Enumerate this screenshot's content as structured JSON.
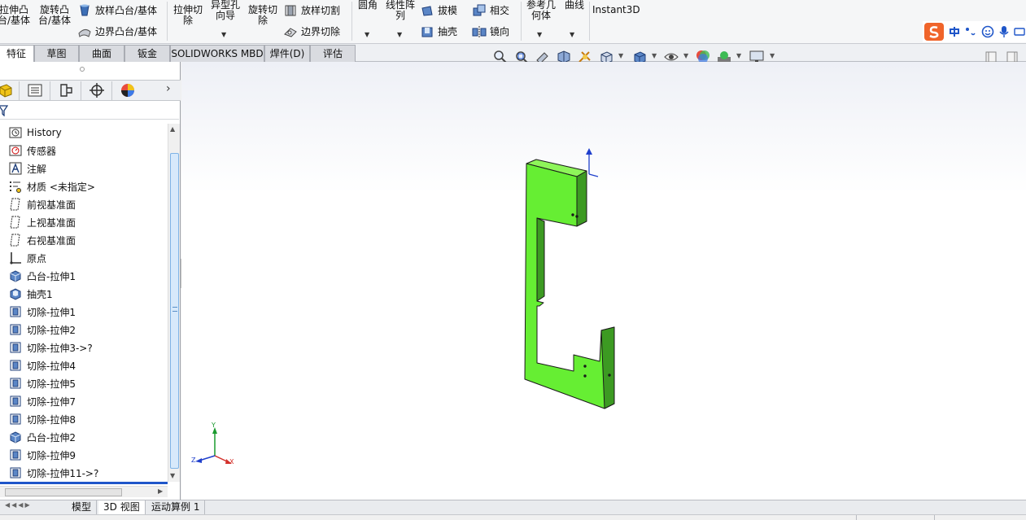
{
  "ribbon": {
    "extrude_boss": "拉伸凸\n台/基体",
    "revolve_boss": "旋转凸\n台/基体",
    "loft_boss": "放样凸台/基体",
    "boundary_boss": "边界凸台/基体",
    "extrude_cut": "拉伸切\n除",
    "hole_wizard": "异型孔\n向导",
    "revolve_cut": "旋转切\n除",
    "loft_cut": "放样切割",
    "boundary_cut": "边界切除",
    "fillet": "圆角",
    "linear_pattern": "线性阵\n列",
    "draft": "拔模",
    "shell": "抽壳",
    "intersect": "相交",
    "mirror": "镜向",
    "ref_geometry": "参考几\n何体",
    "curves": "曲线",
    "instant3d": "Instant3D"
  },
  "tabs": [
    "特征",
    "草图",
    "曲面",
    "钣金",
    "SOLIDWORKS MBD",
    "焊件(D)",
    "评估"
  ],
  "tree": {
    "items": [
      {
        "label": "History",
        "icon": "history-icon"
      },
      {
        "label": "传感器",
        "icon": "sensor-icon"
      },
      {
        "label": "注解",
        "icon": "annotation-icon"
      },
      {
        "label": "材质 <未指定>",
        "icon": "material-icon"
      },
      {
        "label": "前视基准面",
        "icon": "plane-icon"
      },
      {
        "label": "上视基准面",
        "icon": "plane-icon"
      },
      {
        "label": "右视基准面",
        "icon": "plane-icon"
      },
      {
        "label": "原点",
        "icon": "origin-icon"
      },
      {
        "label": "凸台-拉伸1",
        "icon": "boss-extrude-icon"
      },
      {
        "label": "抽壳1",
        "icon": "shell-icon"
      },
      {
        "label": "切除-拉伸1",
        "icon": "cut-extrude-icon"
      },
      {
        "label": "切除-拉伸2",
        "icon": "cut-extrude-icon"
      },
      {
        "label": "切除-拉伸3->?",
        "icon": "cut-extrude-icon"
      },
      {
        "label": "切除-拉伸4",
        "icon": "cut-extrude-icon"
      },
      {
        "label": "切除-拉伸5",
        "icon": "cut-extrude-icon"
      },
      {
        "label": "切除-拉伸7",
        "icon": "cut-extrude-icon"
      },
      {
        "label": "切除-拉伸8",
        "icon": "cut-extrude-icon"
      },
      {
        "label": "凸台-拉伸2",
        "icon": "boss-extrude-icon"
      },
      {
        "label": "切除-拉伸9",
        "icon": "cut-extrude-icon"
      },
      {
        "label": "切除-拉伸11->?",
        "icon": "cut-extrude-icon"
      }
    ]
  },
  "triad": {
    "x": "X",
    "y": "Y",
    "z": "Z"
  },
  "bottom_tabs": [
    "模型",
    "3D 视图",
    "运动算例 1"
  ],
  "colors": {
    "model_green": "#66ee33",
    "model_shadow": "#3c9a22",
    "accent_blue": "#1f3fcc"
  }
}
